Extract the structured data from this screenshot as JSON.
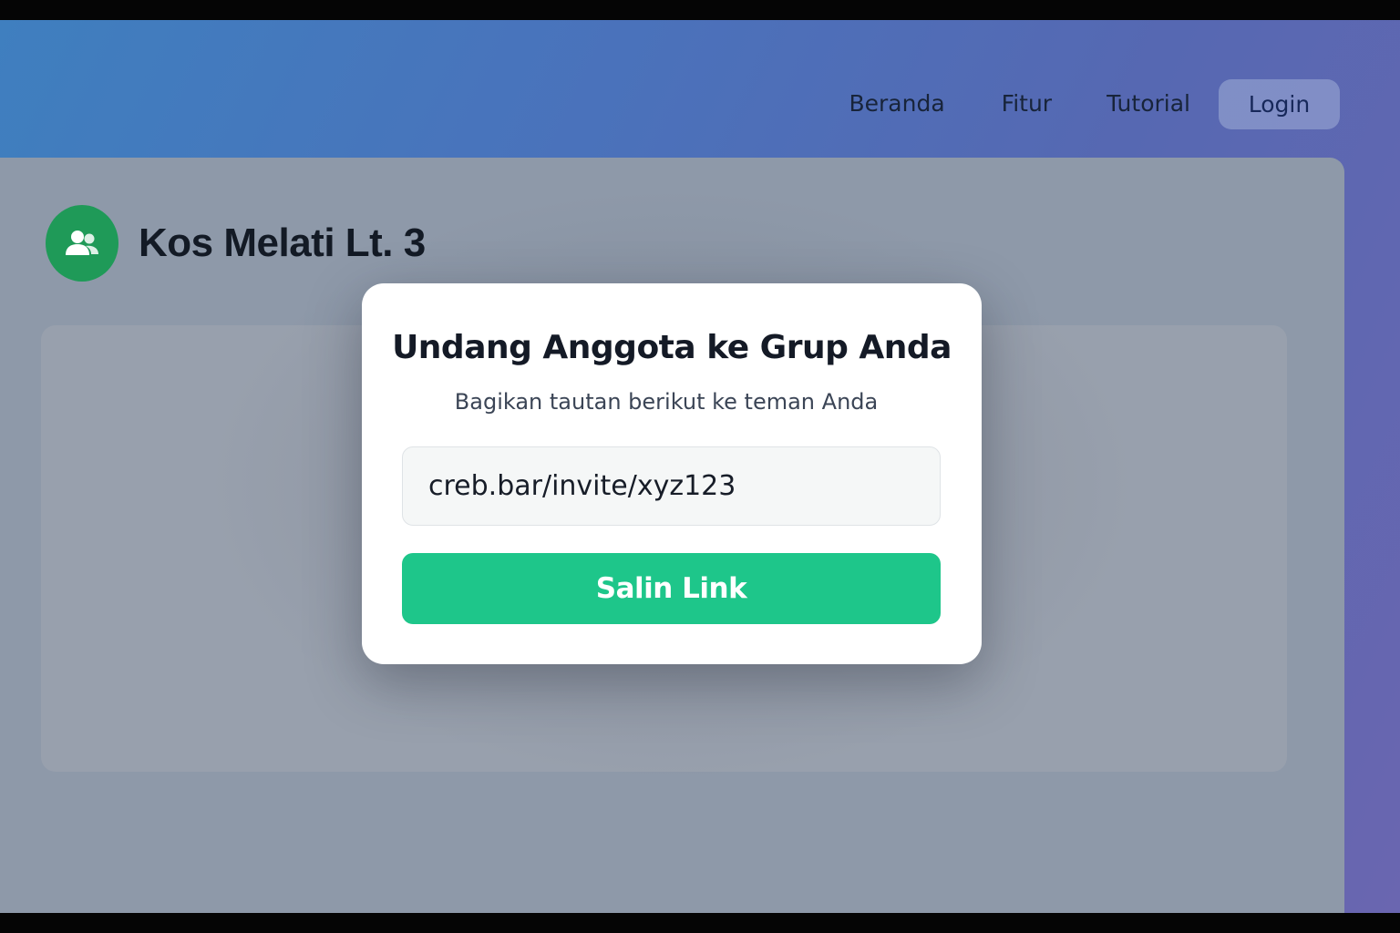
{
  "nav": {
    "items": [
      {
        "label": "Beranda"
      },
      {
        "label": "Fitur"
      },
      {
        "label": "Tutorial"
      }
    ],
    "login_label": "Login"
  },
  "group": {
    "name": "Kos Melati Lt. 3",
    "icon": "users-icon"
  },
  "modal": {
    "title": "Undang Anggota ke Grup Anda",
    "subtitle": "Bagikan tautan berikut ke teman Anda",
    "invite_link": "creb.bar/invite/xyz123",
    "copy_button_label": "Salin Link"
  },
  "colors": {
    "accent_green": "#1ec68a",
    "avatar_green": "#1f9a58",
    "header_gradient_start": "#3f7fbf",
    "header_gradient_end": "#6a66b0"
  }
}
